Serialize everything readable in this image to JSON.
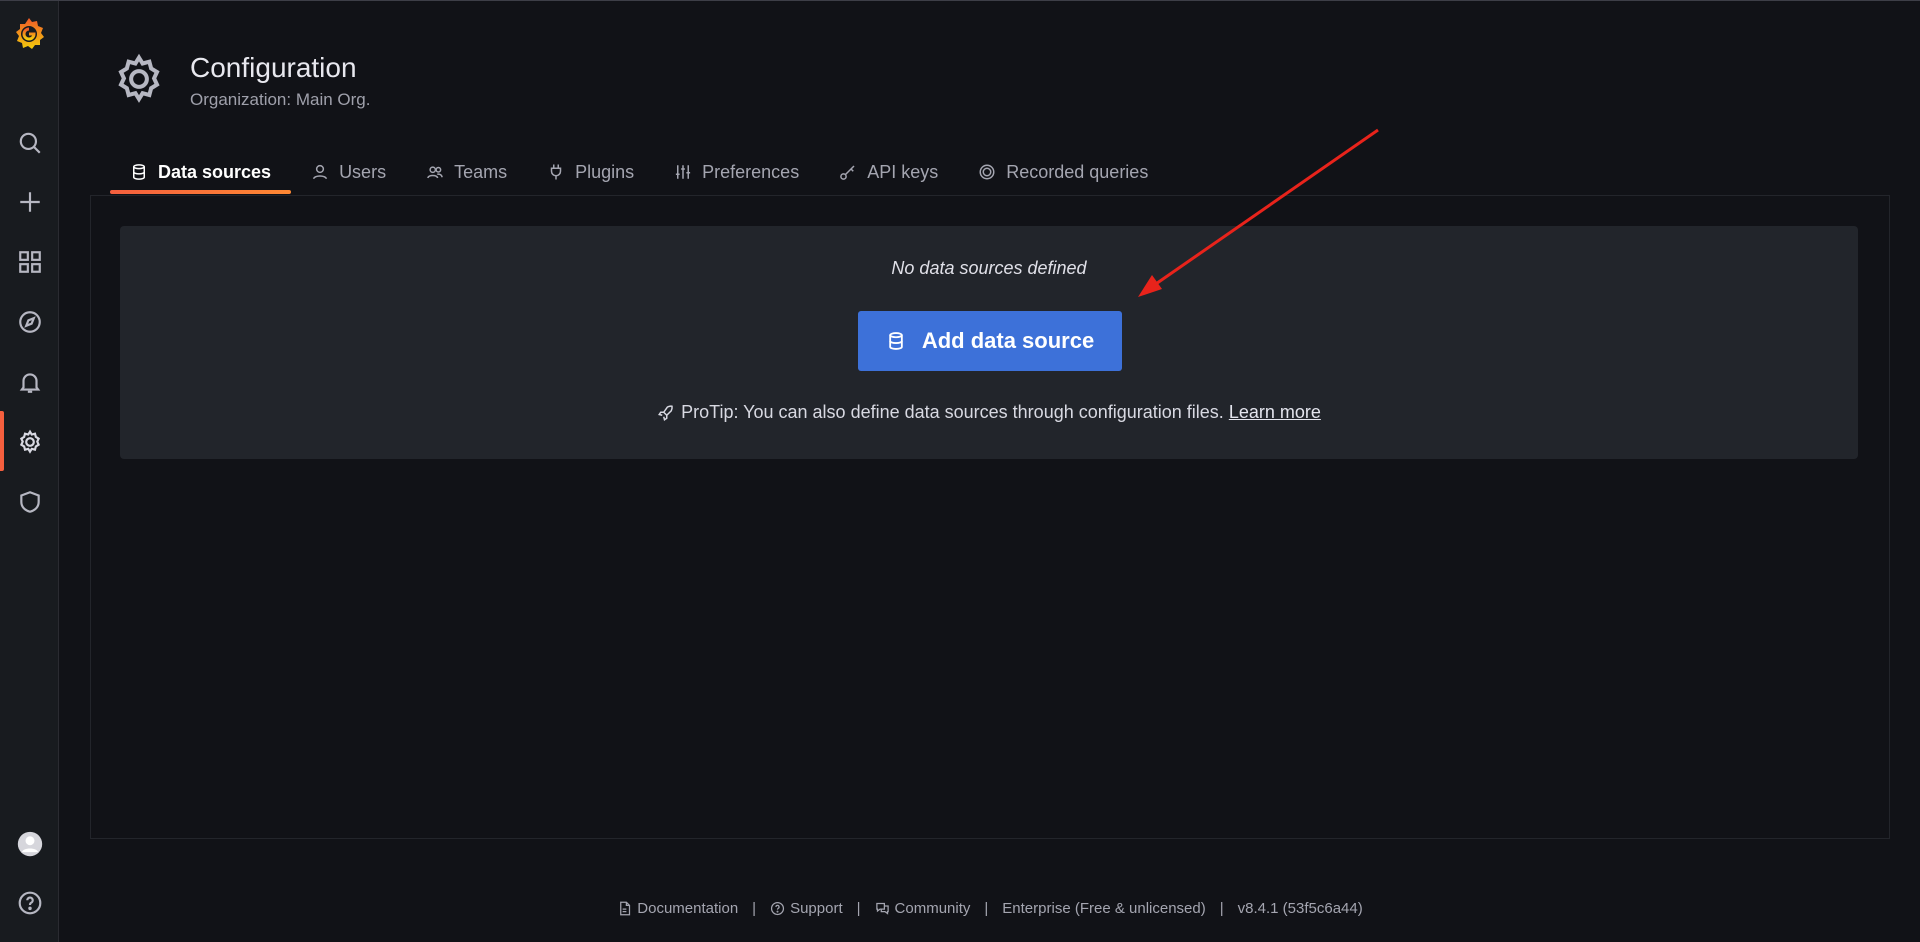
{
  "header": {
    "title": "Configuration",
    "subtitle": "Organization: Main Org."
  },
  "sidebar": {
    "items": [
      {
        "name": "search"
      },
      {
        "name": "create"
      },
      {
        "name": "dashboards"
      },
      {
        "name": "explore"
      },
      {
        "name": "alerting"
      },
      {
        "name": "configuration",
        "active": true
      },
      {
        "name": "server-admin"
      }
    ]
  },
  "tabs": [
    {
      "label": "Data sources",
      "active": true
    },
    {
      "label": "Users"
    },
    {
      "label": "Teams"
    },
    {
      "label": "Plugins"
    },
    {
      "label": "Preferences"
    },
    {
      "label": "API keys"
    },
    {
      "label": "Recorded queries"
    }
  ],
  "empty_state": {
    "title": "No data sources defined",
    "button_label": "Add data source",
    "protip_text": "ProTip: You can also define data sources through configuration files.",
    "learn_more": "Learn more"
  },
  "footer": {
    "documentation": "Documentation",
    "support": "Support",
    "community": "Community",
    "edition": "Enterprise (Free & unlicensed)",
    "version": "v8.4.1 (53f5c6a44)",
    "separator": "|"
  },
  "colors": {
    "accent": "#f55f3e",
    "primary_button": "#3d71d9",
    "arrow": "#e8231b"
  }
}
